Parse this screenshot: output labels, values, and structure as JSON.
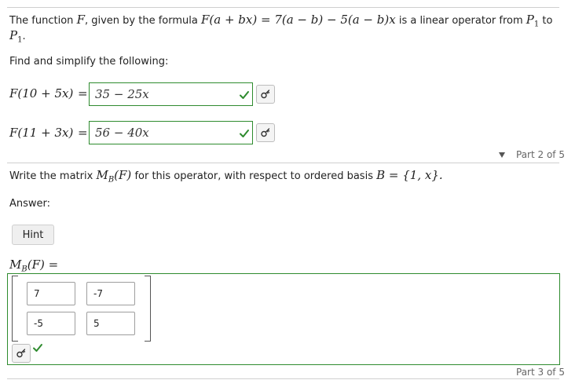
{
  "part2": {
    "intro_prefix": "The function",
    "intro_fn": "F",
    "intro_mid": ", given by the formula",
    "intro_formula": "F(a + bx) = 7(a − b) − 5(a − b)x",
    "intro_suffix": "is a linear operator from",
    "intro_space1": "P",
    "intro_space1_sub": "1",
    "intro_to": "to",
    "intro_space2": "P",
    "intro_space2_sub": "1",
    "intro_end": ".",
    "instruction": "Find and simplify the following:",
    "items": [
      {
        "expr": "F(10 + 5x)",
        "equals": "=",
        "answer": "35 − 25x"
      },
      {
        "expr": "F(11 + 3x)",
        "equals": "=",
        "answer": "56 − 40x"
      }
    ],
    "collapse_icon": "triangle-down-icon",
    "part_label": "Part 2 of 5"
  },
  "part3": {
    "question_prefix": "Write the matrix",
    "question_matrix": "M",
    "question_matrix_sub": "B",
    "question_matrix_arg": "(F)",
    "question_mid": "for this operator, with respect to ordered basis",
    "question_basis": "B = {1, x}.",
    "answer_label": "Answer:",
    "hint_label": "Hint",
    "matrix_label": "M",
    "matrix_label_sub": "B",
    "matrix_label_arg": "(F) =",
    "matrix": [
      [
        "7",
        "-7"
      ],
      [
        "-5",
        "5"
      ]
    ],
    "part_label": "Part 3 of 5"
  },
  "colors": {
    "correct": "#2e8b2e",
    "border_grey": "#cfcfcf"
  }
}
